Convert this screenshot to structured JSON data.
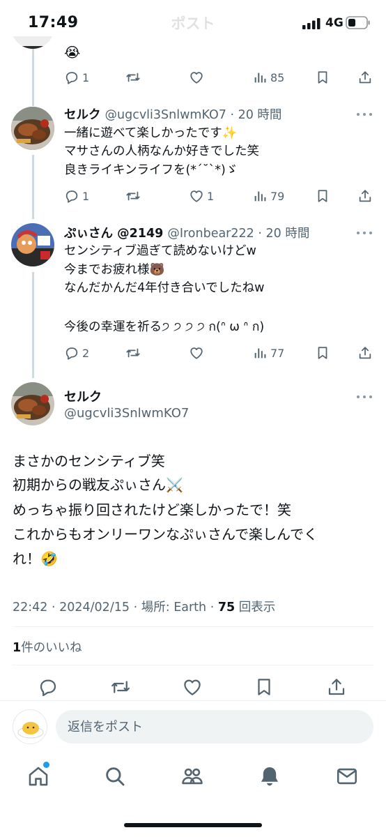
{
  "status_bar": {
    "time": "17:49",
    "network": "4G"
  },
  "header": {
    "title": "ポスト"
  },
  "prev_reply": {
    "emoji": "😭",
    "actions": {
      "replies": "1",
      "retweets": "",
      "likes": "",
      "views": "85"
    }
  },
  "replies": [
    {
      "display_name": "セルク",
      "handle": "@ugcvli3SnlwmKO7",
      "time": "· 20 時間",
      "lines": [
        "一緒に遊べて楽しかったです✨",
        "マサさんの人柄なんか好きでした笑",
        "良きライキンライフを(*ˊ˘ˋ*)ゞ"
      ],
      "actions": {
        "replies": "1",
        "retweets": "",
        "likes": "1",
        "views": "79"
      }
    },
    {
      "display_name": "ぷぃさん @2149",
      "handle": "@Ironbear222",
      "time": "· 20 時間",
      "lines": [
        "センシティブ過ぎて読めないけどw",
        "今までお疲れ様🐻",
        "なんだかんだ4年付き合いでしたねw",
        "",
        "今後の幸運を祈る੭ ੭ ੭ ੭ ก(ᐢ ω ᐢ ก)"
      ],
      "actions": {
        "replies": "2",
        "retweets": "",
        "likes": "",
        "views": "77"
      }
    }
  ],
  "main_tweet": {
    "display_name": "セルク",
    "handle": "@ugcvli3SnlwmKO7",
    "lines": [
      "まさかのセンシティブ笑",
      "初期からの戦友ぷぃさん⚔️",
      "めっちゃ振り回されたけど楽しかったで！笑",
      "これからもオンリーワンなぷぃさんで楽しんでく",
      "れ！🤣"
    ],
    "meta": {
      "time_date": "22:42 · 2024/02/15",
      "place_label": "場所:",
      "place": "Earth",
      "views": "75",
      "views_label": "回表示"
    },
    "likes": {
      "count": "1",
      "label": "件のいいね"
    }
  },
  "reply_bar": {
    "placeholder": "返信をポスト"
  },
  "tabs": [
    {
      "icon": "home-icon"
    },
    {
      "icon": "search-icon"
    },
    {
      "icon": "communities-icon"
    },
    {
      "icon": "notifications-icon"
    },
    {
      "icon": "messages-icon"
    }
  ],
  "colors": {
    "text": "#0f1419",
    "secondary": "#536471",
    "accent": "#1d9bf0",
    "divider": "#eff3f4",
    "thread": "#cfd9de"
  }
}
